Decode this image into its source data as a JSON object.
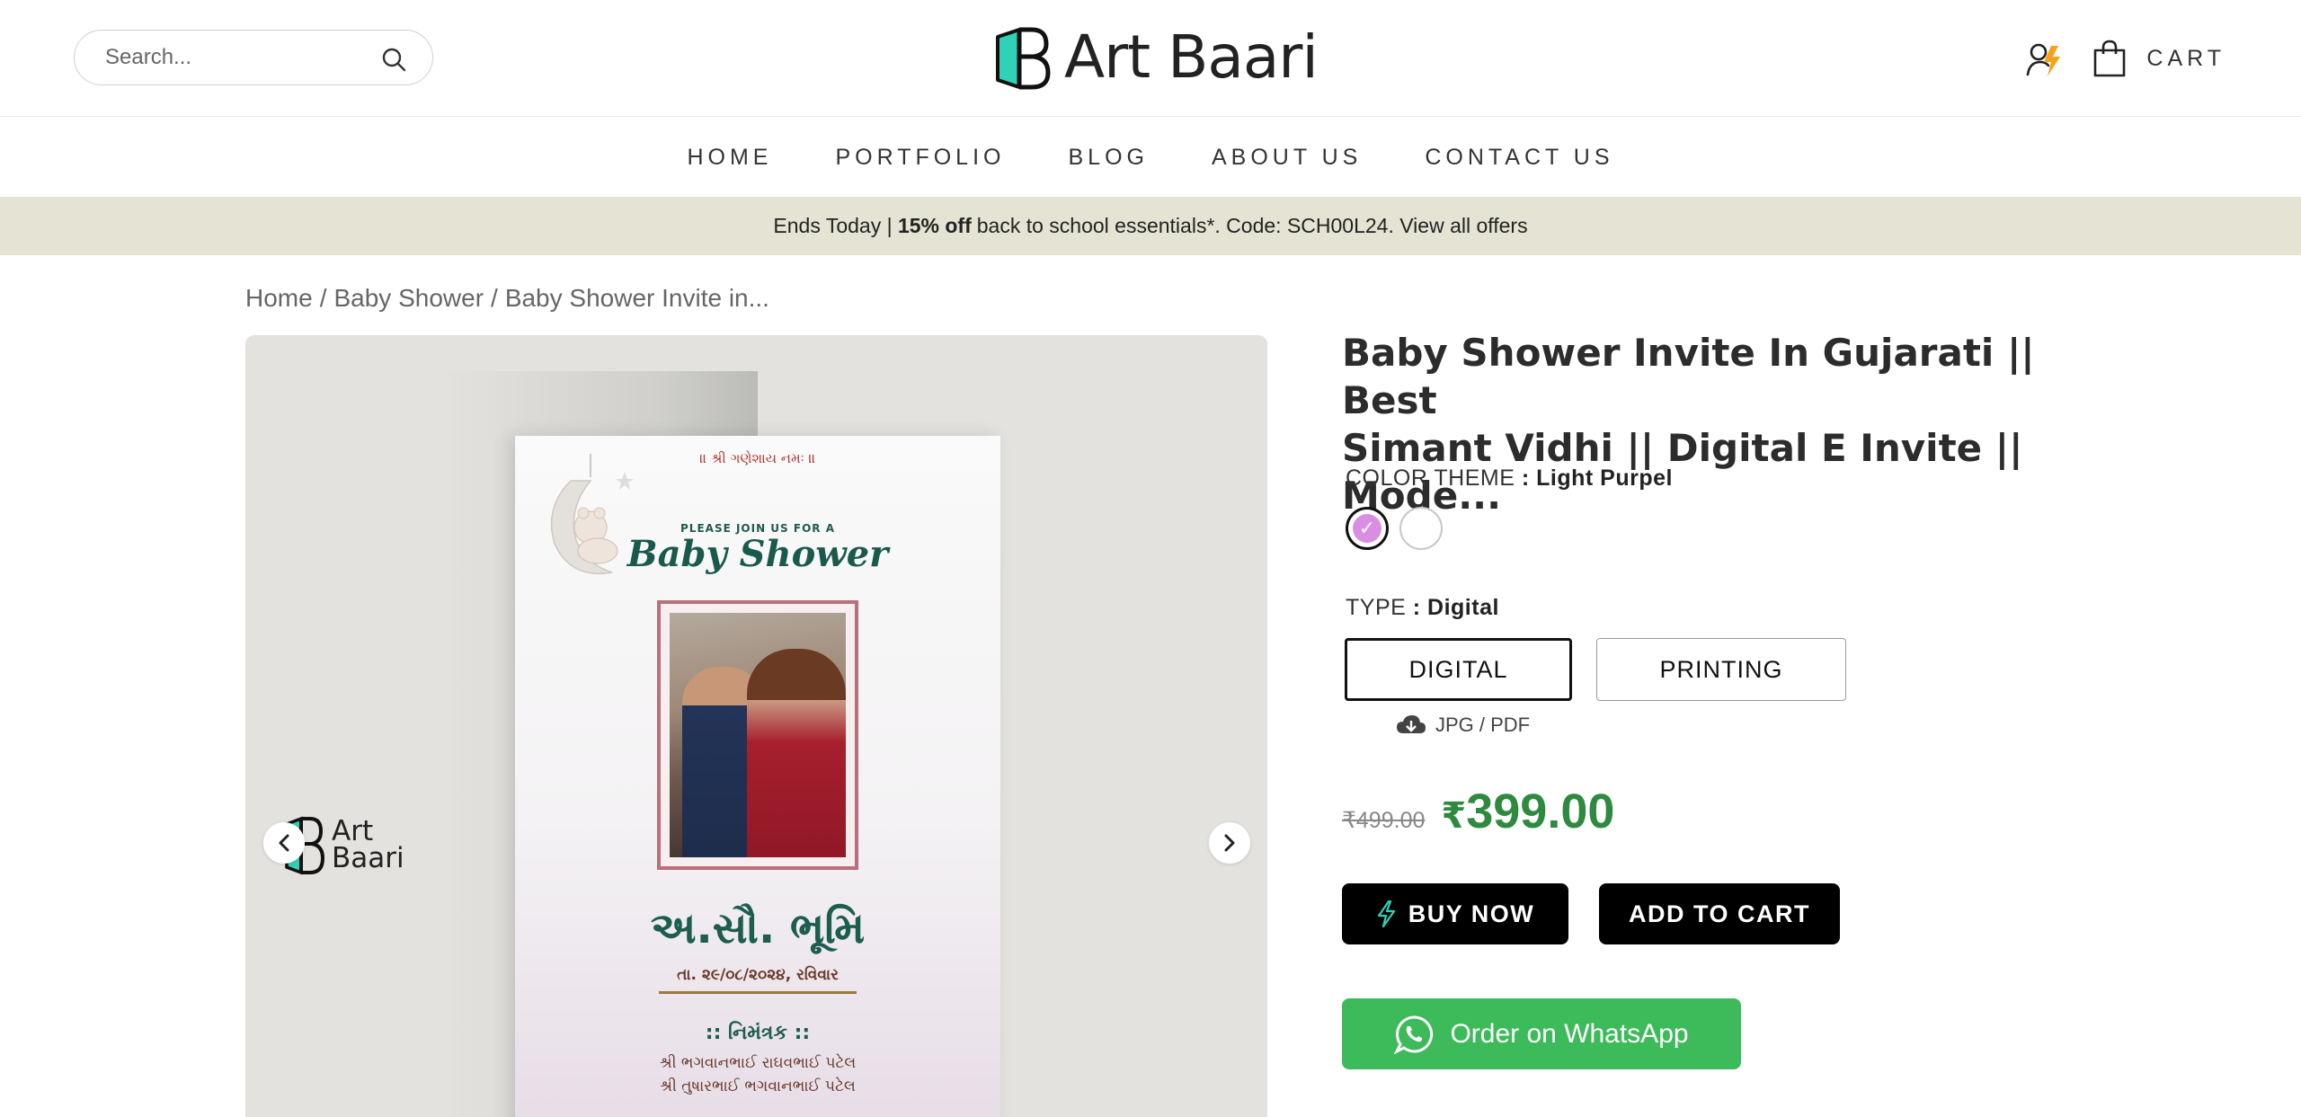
{
  "header": {
    "search_placeholder": "Search...",
    "logo_text": "Art Baari",
    "cart_label": "CART"
  },
  "nav": {
    "items": [
      "HOME",
      "PORTFOLIO",
      "BLOG",
      "ABOUT US",
      "CONTACT US"
    ]
  },
  "promo": {
    "prefix": "Ends Today |",
    "highlight": "15% off",
    "rest": "back to school essentials*. Code: SCH00L24. View all offers"
  },
  "breadcrumb": {
    "items": [
      "Home",
      "/",
      "Baby Shower",
      "/",
      "Baby Shower Invite in..."
    ]
  },
  "gallery": {
    "logo_line1": "Art",
    "logo_line2": "Baari",
    "card": {
      "top_blessing": "॥ શ્રી ગણેશાય નમઃ ॥",
      "join_text": "PLEASE JOIN US FOR A",
      "event_title": "Baby Shower",
      "name": "અ.સૌ. ભૂમિ",
      "date": "તા. ૨૯/૦૮/૨૦૨૪, રવિવાર",
      "inviter_heading": ":: નિમંત્રક ::",
      "inviter_1": "શ્રી ભગવાનભાઈ રાઘવભાઈ પટેલ",
      "inviter_2": "શ્રી તુષારભાઈ ભગવાનભાઈ પટેલ"
    }
  },
  "product": {
    "title_line1": "Baby Shower Invite In Gujarati || Best",
    "title_line2": "Simant Vidhi || Digital E Invite || Mode...",
    "color_label": "COLOR THEME",
    "color_value": ": Light Purpel",
    "type_label": "TYPE",
    "type_value": ": Digital",
    "type_options": [
      "DIGITAL",
      "PRINTING"
    ],
    "format": "JPG / PDF",
    "old_price": "₹499.00",
    "currency": "₹",
    "new_price": "399.00",
    "buy_now": "BUY NOW",
    "add_to_cart": "ADD TO CART",
    "whatsapp": "Order on WhatsApp"
  },
  "colors": {
    "promo_bg": "#e4e3d4",
    "price_green": "#2e8a3e",
    "whatsapp_green": "#3dbb5a",
    "swatch_purple": "#d98ee3",
    "brand_teal": "#2fd1b7"
  }
}
